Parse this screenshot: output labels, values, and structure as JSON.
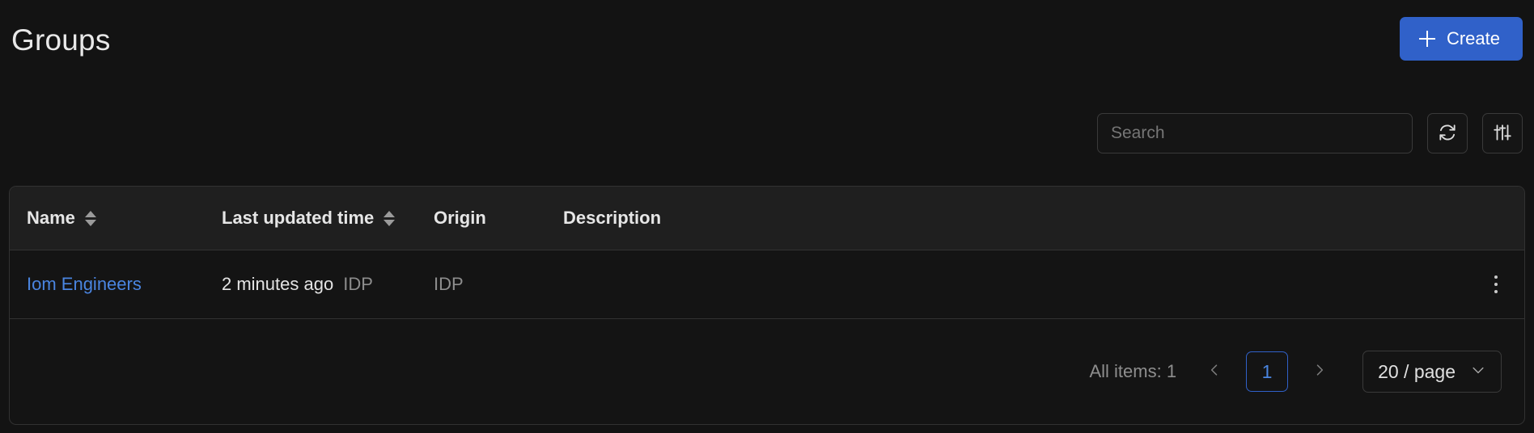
{
  "header": {
    "title": "Groups",
    "create_label": "Create",
    "create_icon": "plus-icon",
    "accent_color": "#3061c9"
  },
  "toolbar": {
    "search_placeholder": "Search",
    "search_value": "",
    "refresh_icon": "refresh-icon",
    "filter_icon": "filter-sliders-icon"
  },
  "table": {
    "columns": [
      {
        "key": "name",
        "label": "Name",
        "sortable": true
      },
      {
        "key": "updated",
        "label": "Last updated time",
        "sortable": true
      },
      {
        "key": "origin",
        "label": "Origin",
        "sortable": false
      },
      {
        "key": "description",
        "label": "Description",
        "sortable": false
      }
    ],
    "rows": [
      {
        "name": "Iom Engineers",
        "updated": "2 minutes ago",
        "updated_source": "IDP",
        "origin": "IDP",
        "description": "",
        "actions_icon": "kebab-menu-icon"
      }
    ]
  },
  "pagination": {
    "all_items_label": "All items: 1",
    "prev_icon": "chevron-left-icon",
    "next_icon": "chevron-right-icon",
    "current_page": "1",
    "page_size_label": "20 / page",
    "page_size_icon": "chevron-down-icon"
  },
  "colors": {
    "page_bg": "#131313",
    "table_header_bg": "#1f1f1f",
    "row_bg": "#141414",
    "border": "#323232",
    "link": "#4a85e0",
    "muted_text": "#8d8d8d"
  }
}
